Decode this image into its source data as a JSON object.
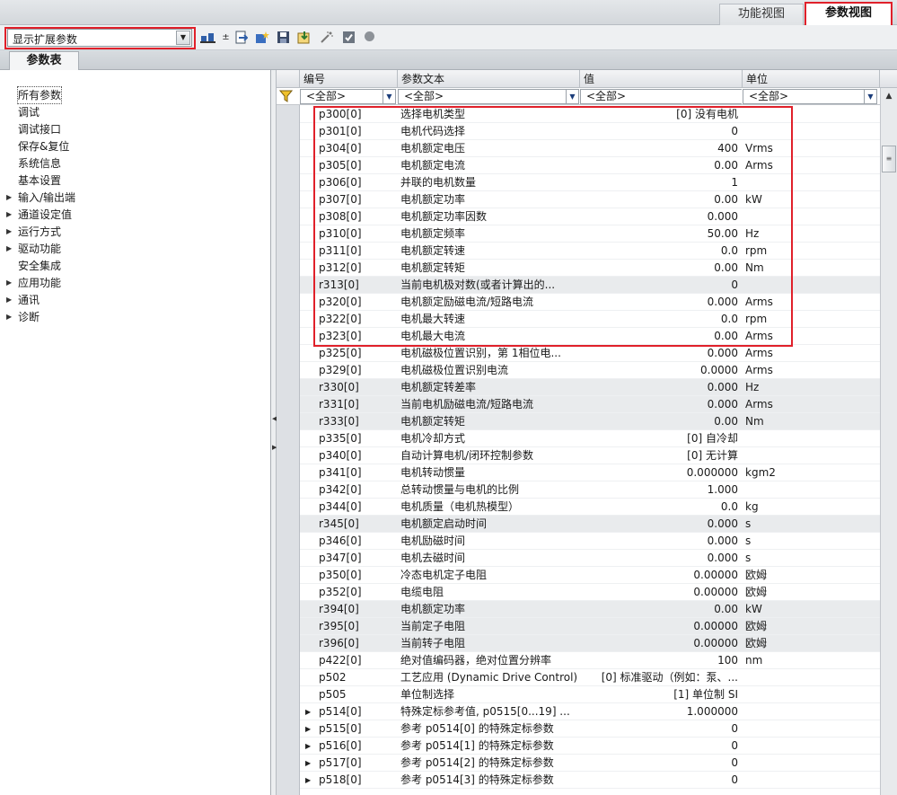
{
  "view_tabs": {
    "function_view": "功能视图",
    "parameter_view": "参数视图"
  },
  "toolbar": {
    "display_select": "显示扩展参数"
  },
  "param_table_tab": "参数表",
  "tree": {
    "items": [
      {
        "label": "所有参数",
        "expandable": false,
        "selected": true
      },
      {
        "label": "调试",
        "expandable": false
      },
      {
        "label": "调试接口",
        "expandable": false
      },
      {
        "label": "保存&复位",
        "expandable": false
      },
      {
        "label": "系统信息",
        "expandable": false
      },
      {
        "label": "基本设置",
        "expandable": false
      },
      {
        "label": "输入/输出端",
        "expandable": true
      },
      {
        "label": "通道设定值",
        "expandable": true
      },
      {
        "label": "运行方式",
        "expandable": true
      },
      {
        "label": "驱动功能",
        "expandable": true
      },
      {
        "label": "安全集成",
        "expandable": false
      },
      {
        "label": "应用功能",
        "expandable": true
      },
      {
        "label": "通讯",
        "expandable": true
      },
      {
        "label": "诊断",
        "expandable": true
      }
    ]
  },
  "grid": {
    "columns": {
      "num": "编号",
      "text": "参数文本",
      "value": "值",
      "unit": "单位"
    },
    "filters": {
      "num": "<全部>",
      "text": "<全部>",
      "value": "<全部>",
      "unit": "<全部>"
    },
    "rows": [
      {
        "num": "p300[0]",
        "text": "选择电机类型",
        "value": "[0] 没有电机",
        "unit": "",
        "gray": false
      },
      {
        "num": "p301[0]",
        "text": "电机代码选择",
        "value": "0",
        "unit": "",
        "gray": false
      },
      {
        "num": "p304[0]",
        "text": "电机额定电压",
        "value": "400",
        "unit": "Vrms",
        "gray": false
      },
      {
        "num": "p305[0]",
        "text": "电机额定电流",
        "value": "0.00",
        "unit": "Arms",
        "gray": false
      },
      {
        "num": "p306[0]",
        "text": "并联的电机数量",
        "value": "1",
        "unit": "",
        "gray": false
      },
      {
        "num": "p307[0]",
        "text": "电机额定功率",
        "value": "0.00",
        "unit": "kW",
        "gray": false
      },
      {
        "num": "p308[0]",
        "text": "电机额定功率因数",
        "value": "0.000",
        "unit": "",
        "gray": false
      },
      {
        "num": "p310[0]",
        "text": "电机额定频率",
        "value": "50.00",
        "unit": "Hz",
        "gray": false
      },
      {
        "num": "p311[0]",
        "text": "电机额定转速",
        "value": "0.0",
        "unit": "rpm",
        "gray": false
      },
      {
        "num": "p312[0]",
        "text": "电机额定转矩",
        "value": "0.00",
        "unit": "Nm",
        "gray": false
      },
      {
        "num": "r313[0]",
        "text": "当前电机极对数(或者计算出的...",
        "value": "0",
        "unit": "",
        "gray": true
      },
      {
        "num": "p320[0]",
        "text": "电机额定励磁电流/短路电流",
        "value": "0.000",
        "unit": "Arms",
        "gray": false
      },
      {
        "num": "p322[0]",
        "text": "电机最大转速",
        "value": "0.0",
        "unit": "rpm",
        "gray": false
      },
      {
        "num": "p323[0]",
        "text": "电机最大电流",
        "value": "0.00",
        "unit": "Arms",
        "gray": false
      },
      {
        "num": "p325[0]",
        "text": "电机磁极位置识别，第 1相位电...",
        "value": "0.000",
        "unit": "Arms",
        "gray": false
      },
      {
        "num": "p329[0]",
        "text": "电机磁极位置识别电流",
        "value": "0.0000",
        "unit": "Arms",
        "gray": false
      },
      {
        "num": "r330[0]",
        "text": "电机额定转差率",
        "value": "0.000",
        "unit": "Hz",
        "gray": true
      },
      {
        "num": "r331[0]",
        "text": "当前电机励磁电流/短路电流",
        "value": "0.000",
        "unit": "Arms",
        "gray": true
      },
      {
        "num": "r333[0]",
        "text": "电机额定转矩",
        "value": "0.00",
        "unit": "Nm",
        "gray": true
      },
      {
        "num": "p335[0]",
        "text": "电机冷却方式",
        "value": "[0] 自冷却",
        "unit": "",
        "gray": false
      },
      {
        "num": "p340[0]",
        "text": "自动计算电机/闭环控制参数",
        "value": "[0] 无计算",
        "unit": "",
        "gray": false
      },
      {
        "num": "p341[0]",
        "text": "电机转动惯量",
        "value": "0.000000",
        "unit": "kgm2",
        "gray": false
      },
      {
        "num": "p342[0]",
        "text": "总转动惯量与电机的比例",
        "value": "1.000",
        "unit": "",
        "gray": false
      },
      {
        "num": "p344[0]",
        "text": "电机质量（电机热模型）",
        "value": "0.0",
        "unit": "kg",
        "gray": false
      },
      {
        "num": "r345[0]",
        "text": "电机额定启动时间",
        "value": "0.000",
        "unit": "s",
        "gray": true
      },
      {
        "num": "p346[0]",
        "text": "电机励磁时间",
        "value": "0.000",
        "unit": "s",
        "gray": false
      },
      {
        "num": "p347[0]",
        "text": "电机去磁时间",
        "value": "0.000",
        "unit": "s",
        "gray": false
      },
      {
        "num": "p350[0]",
        "text": "冷态电机定子电阻",
        "value": "0.00000",
        "unit": "欧姆",
        "gray": false
      },
      {
        "num": "p352[0]",
        "text": "电缆电阻",
        "value": "0.00000",
        "unit": "欧姆",
        "gray": false
      },
      {
        "num": "r394[0]",
        "text": "电机额定功率",
        "value": "0.00",
        "unit": "kW",
        "gray": true
      },
      {
        "num": "r395[0]",
        "text": "当前定子电阻",
        "value": "0.00000",
        "unit": "欧姆",
        "gray": true
      },
      {
        "num": "r396[0]",
        "text": "当前转子电阻",
        "value": "0.00000",
        "unit": "欧姆",
        "gray": true
      },
      {
        "num": "p422[0]",
        "text": "绝对值编码器，绝对位置分辨率",
        "value": "100",
        "unit": "nm",
        "gray": false
      },
      {
        "num": "p502",
        "text": "工艺应用 (Dynamic Drive Control)",
        "value": "[0] 标准驱动（例如：泵、...",
        "unit": "",
        "gray": false
      },
      {
        "num": "p505",
        "text": "单位制选择",
        "value": "[1] 单位制 SI",
        "unit": "",
        "gray": false
      },
      {
        "num": "p514[0]",
        "text": "特殊定标参考值, p0515[0...19] ...",
        "value": "1.000000",
        "unit": "",
        "gray": false,
        "expandable": true
      },
      {
        "num": "p515[0]",
        "text": "参考 p0514[0] 的特殊定标参数",
        "value": "0",
        "unit": "",
        "gray": false,
        "expandable": true
      },
      {
        "num": "p516[0]",
        "text": "参考 p0514[1] 的特殊定标参数",
        "value": "0",
        "unit": "",
        "gray": false,
        "expandable": true
      },
      {
        "num": "p517[0]",
        "text": "参考 p0514[2] 的特殊定标参数",
        "value": "0",
        "unit": "",
        "gray": false,
        "expandable": true
      },
      {
        "num": "p518[0]",
        "text": "参考 p0514[3] 的特殊定标参数",
        "value": "0",
        "unit": "",
        "gray": false,
        "expandable": true
      }
    ]
  },
  "icons": [
    "compare-icon",
    "export-icon",
    "wizard-icon",
    "save-icon",
    "import-icon",
    "initialize-icon",
    "checkbox-icon",
    "status-dot-icon",
    "filter-icon"
  ],
  "colors": {
    "highlight_red": "#e0202a",
    "gray_row": "#e9ebed",
    "header": "#dfe2e6"
  }
}
